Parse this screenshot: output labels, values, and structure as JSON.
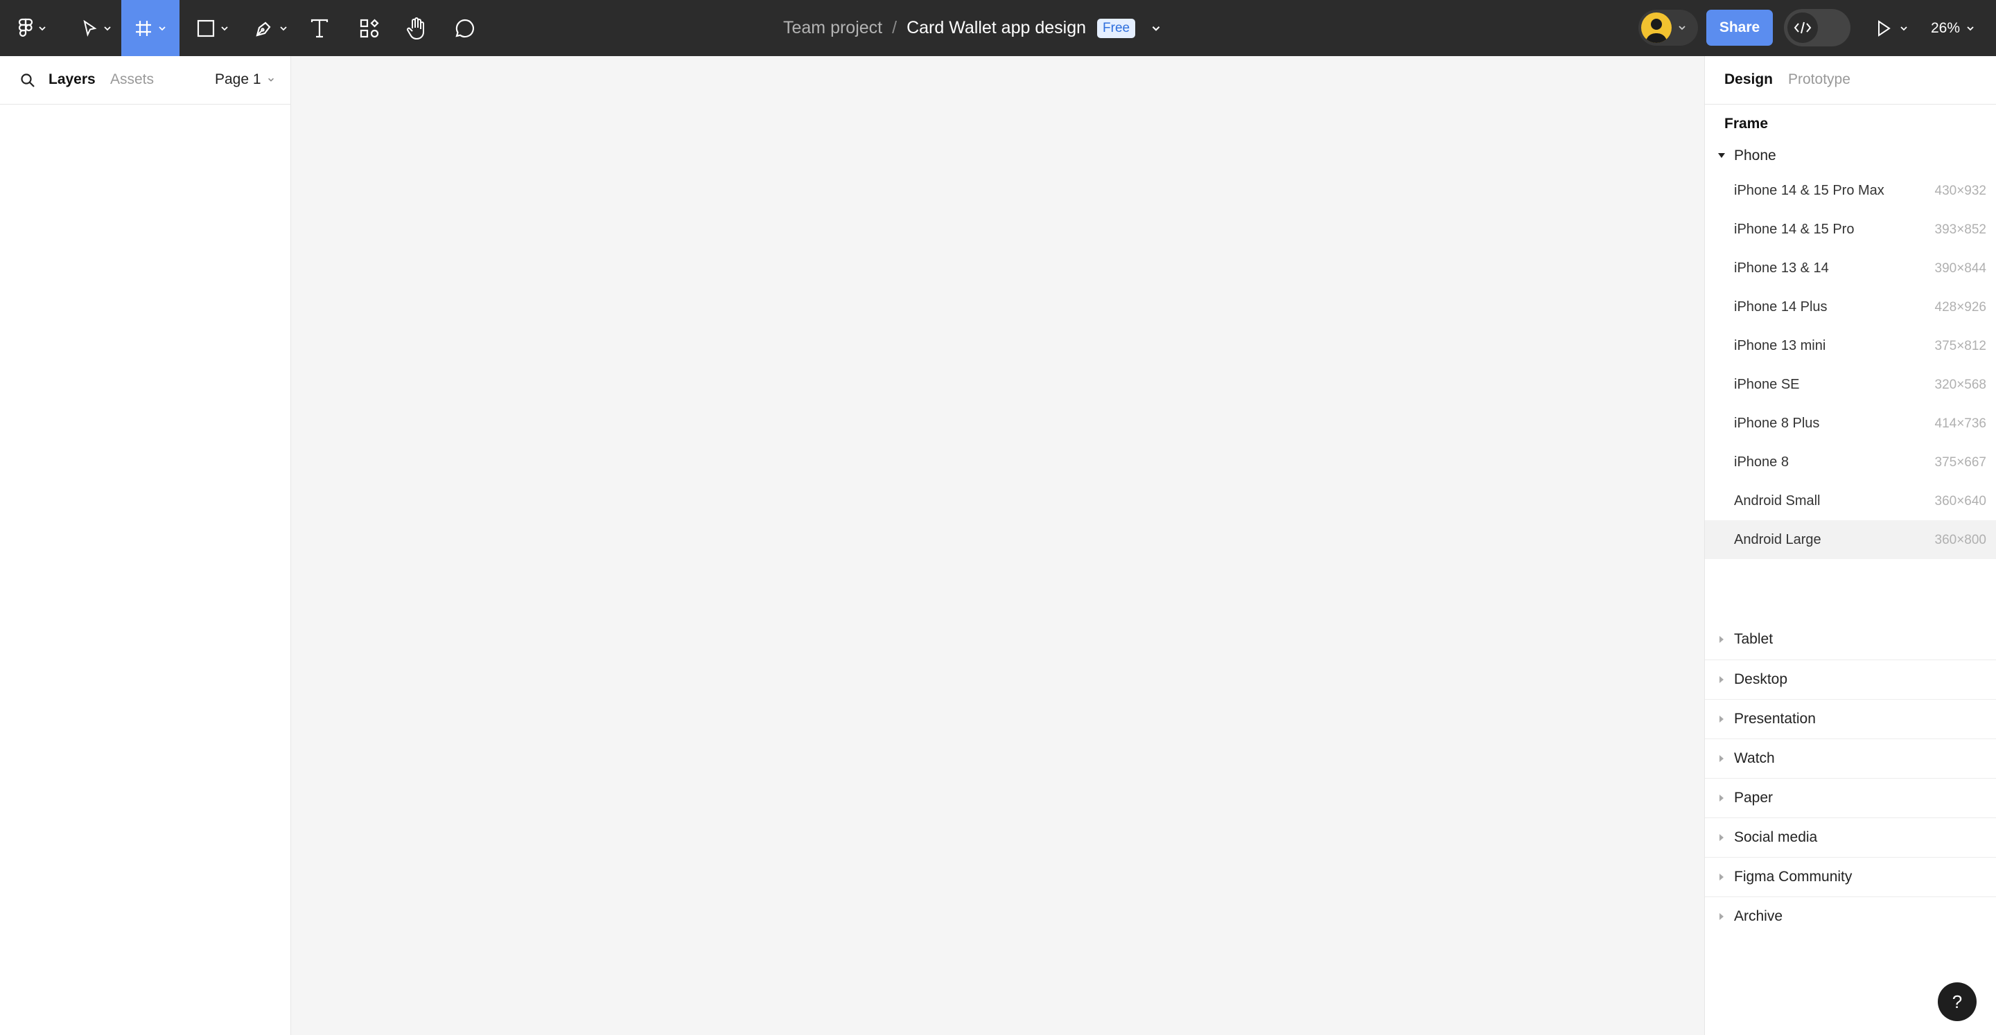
{
  "toolbar": {
    "breadcrumb_team": "Team project",
    "breadcrumb_sep": "/",
    "file_name": "Card Wallet app design",
    "plan_badge": "Free",
    "share_label": "Share",
    "zoom": "26%",
    "tools": [
      "main-menu-icon",
      "move-icon",
      "frame-icon",
      "rectangle-icon",
      "pen-icon",
      "text-icon",
      "resources-icon",
      "hand-icon",
      "comment-icon"
    ],
    "accent_color": "#5b8def"
  },
  "left_panel": {
    "tab_layers": "Layers",
    "tab_assets": "Assets",
    "page": "Page 1"
  },
  "right_panel": {
    "tab_design": "Design",
    "tab_prototype": "Prototype",
    "section_title": "Frame",
    "phone_group": "Phone",
    "phone_presets": [
      {
        "name": "iPhone 14 & 15 Pro Max",
        "size": "430×932"
      },
      {
        "name": "iPhone 14 & 15 Pro",
        "size": "393×852"
      },
      {
        "name": "iPhone 13 & 14",
        "size": "390×844"
      },
      {
        "name": "iPhone 14 Plus",
        "size": "428×926"
      },
      {
        "name": "iPhone 13 mini",
        "size": "375×812"
      },
      {
        "name": "iPhone SE",
        "size": "320×568"
      },
      {
        "name": "iPhone 8 Plus",
        "size": "414×736"
      },
      {
        "name": "iPhone 8",
        "size": "375×667"
      },
      {
        "name": "Android Small",
        "size": "360×640"
      },
      {
        "name": "Android Large",
        "size": "360×800"
      }
    ],
    "collapsed_groups": [
      "Tablet",
      "Desktop",
      "Presentation",
      "Watch",
      "Paper",
      "Social media",
      "Figma Community",
      "Archive"
    ],
    "help_label": "?"
  }
}
